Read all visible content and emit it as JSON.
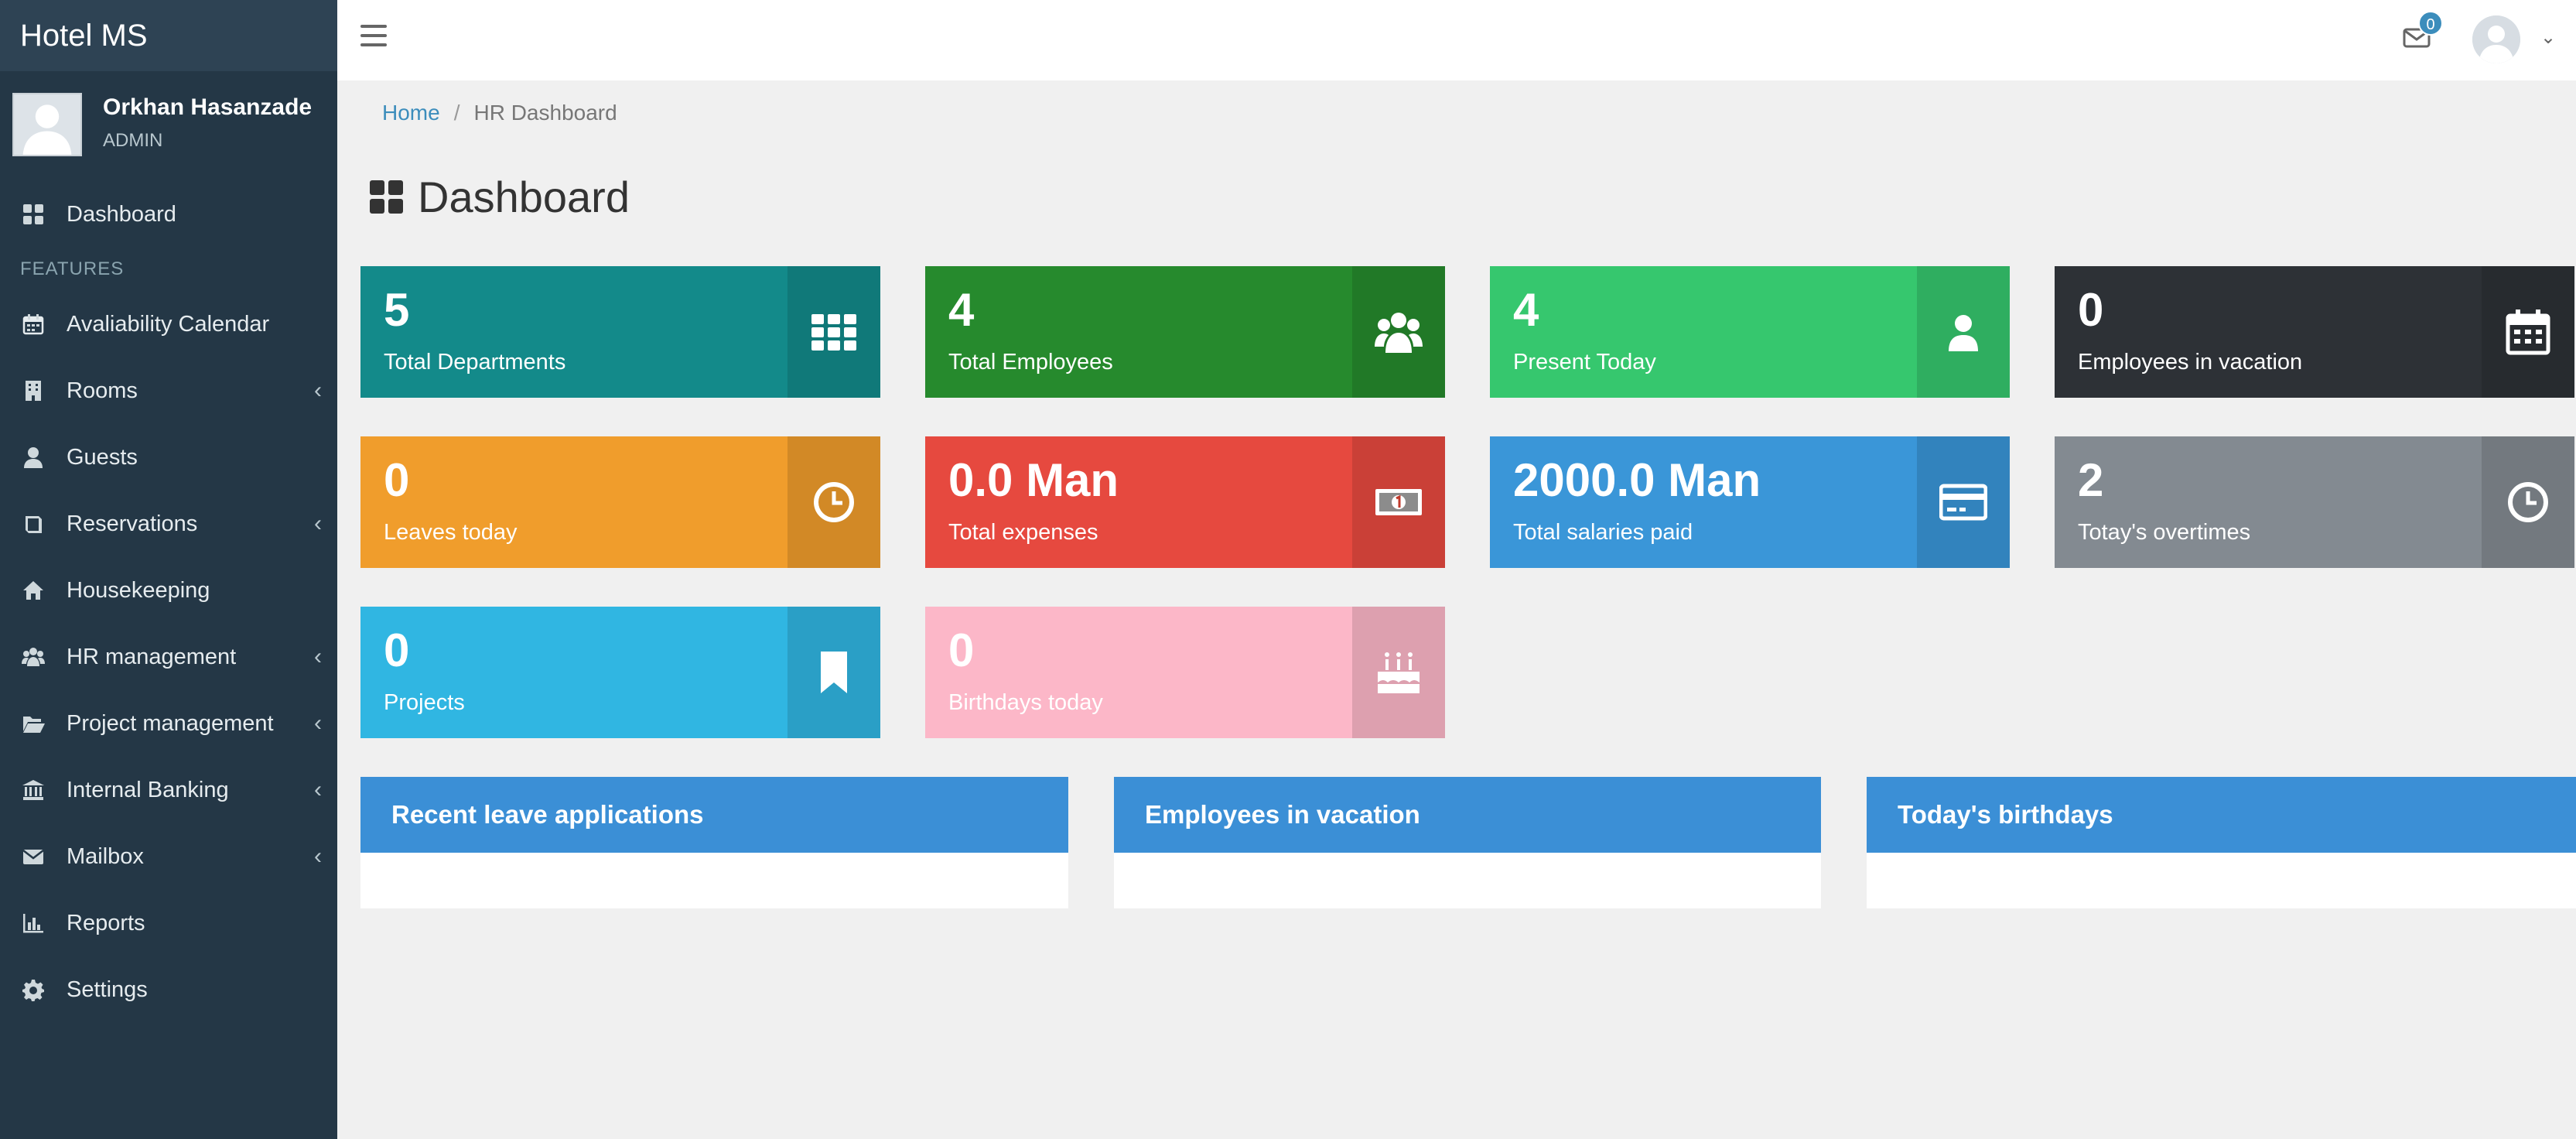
{
  "app": {
    "brand": "Hotel MS"
  },
  "user": {
    "name": "Orkhan Hasanzade",
    "role": "ADMIN"
  },
  "sidebar": {
    "dashboard": "Dashboard",
    "header": "FEATURES",
    "items": [
      {
        "label": "Avaliability Calendar",
        "icon": "calendar-icon",
        "has_children": false
      },
      {
        "label": "Rooms",
        "icon": "building-icon",
        "has_children": true
      },
      {
        "label": "Guests",
        "icon": "user-icon",
        "has_children": false
      },
      {
        "label": "Reservations",
        "icon": "book-icon",
        "has_children": true
      },
      {
        "label": "Housekeeping",
        "icon": "home-icon",
        "has_children": false
      },
      {
        "label": "HR management",
        "icon": "users-icon",
        "has_children": true
      },
      {
        "label": "Project management",
        "icon": "folder-open-icon",
        "has_children": true
      },
      {
        "label": "Internal Banking",
        "icon": "bank-icon",
        "has_children": true
      },
      {
        "label": "Mailbox",
        "icon": "envelope-icon",
        "has_children": true
      },
      {
        "label": "Reports",
        "icon": "bar-chart-icon",
        "has_children": false
      },
      {
        "label": "Settings",
        "icon": "gear-icon",
        "has_children": false
      }
    ]
  },
  "topbar": {
    "mail_count": "0"
  },
  "breadcrumb": {
    "home": "Home",
    "separator": "/",
    "current": "HR Dashboard"
  },
  "page": {
    "title": "Dashboard"
  },
  "tiles": [
    {
      "value": "5",
      "label": "Total Departments",
      "color": "#138a8a",
      "icon": "grid-icon"
    },
    {
      "value": "4",
      "label": "Total Employees",
      "color": "#268a2d",
      "icon": "users-icon"
    },
    {
      "value": "4",
      "label": "Present Today",
      "color": "#36c76e",
      "icon": "user-icon"
    },
    {
      "value": "0",
      "label": "Employees in vacation",
      "color": "#2d3136",
      "icon": "calendar-icon"
    },
    {
      "value": "0",
      "label": "Leaves today",
      "color": "#f09d2c",
      "icon": "clock-icon"
    },
    {
      "value": "0.0 Man",
      "label": "Total expenses",
      "color": "#e6493f",
      "icon": "money-icon"
    },
    {
      "value": "2000.0 Man",
      "label": "Total salaries paid",
      "color": "#3a96d8",
      "icon": "credit-card-icon"
    },
    {
      "value": "2",
      "label": "Totay's overtimes",
      "color": "#838a91",
      "icon": "clock-icon"
    },
    {
      "value": "0",
      "label": "Projects",
      "color": "#30b6e2",
      "icon": "bookmark-icon"
    },
    {
      "value": "0",
      "label": "Birthdays today",
      "color": "#fcb7c8",
      "icon": "birthday-cake-icon"
    }
  ],
  "panels": [
    {
      "title": "Recent leave applications"
    },
    {
      "title": "Employees in vacation"
    },
    {
      "title": "Today's birthdays"
    }
  ],
  "colors": {
    "sidebar": "#243746",
    "brand_bar": "#2e4354",
    "panel_header": "#3b8fd6",
    "link": "#3c8dbc"
  }
}
